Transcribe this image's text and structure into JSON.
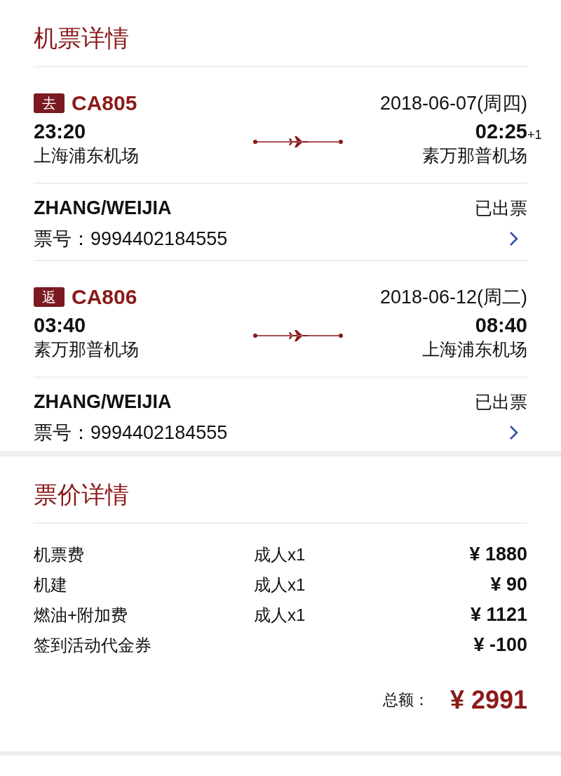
{
  "ticket_section": {
    "title": "机票详情"
  },
  "flights": [
    {
      "badge": "去",
      "flight_no": "CA805",
      "date": "2018-06-07(周四)",
      "dep_time": "23:20",
      "dep_airport": "上海浦东机场",
      "arr_time": "02:25",
      "arr_day_offset": "+1",
      "arr_airport": "素万那普机场",
      "passenger": "ZHANG/WEIJIA",
      "status": "已出票",
      "ticket_label": "票号：",
      "ticket_no": "9994402184555"
    },
    {
      "badge": "返",
      "flight_no": "CA806",
      "date": "2018-06-12(周二)",
      "dep_time": "03:40",
      "dep_airport": "素万那普机场",
      "arr_time": "08:40",
      "arr_airport": "上海浦东机场",
      "passenger": "ZHANG/WEIJIA",
      "status": "已出票",
      "ticket_label": "票号：",
      "ticket_no": "9994402184555"
    }
  ],
  "price_section": {
    "title": "票价详情",
    "rows": [
      {
        "item": "机票费",
        "qty": "成人x1",
        "amount": "¥ 1880"
      },
      {
        "item": "机建",
        "qty": "成人x1",
        "amount": "¥ 90"
      },
      {
        "item": "燃油+附加费",
        "qty": "成人x1",
        "amount": "¥ 1121"
      },
      {
        "item": "签到活动代金券",
        "amount": "¥ -100"
      }
    ],
    "total_label": "总额：",
    "total": "¥ 2991"
  }
}
